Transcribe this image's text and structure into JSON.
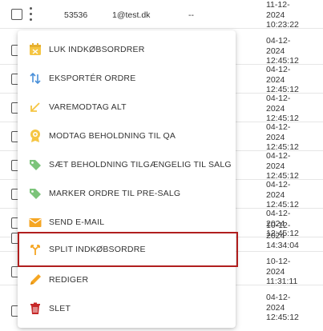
{
  "rows": [
    {
      "id": "53536",
      "email": "1@test.dk",
      "dash": "--",
      "date": [
        "11-12-",
        "2024",
        "10:23:22"
      ]
    },
    {
      "date": [
        "04-12-",
        "2024",
        "12:45:12"
      ]
    },
    {
      "date": [
        "04-12-",
        "2024",
        "12:45:12"
      ]
    },
    {
      "date": [
        "04-12-",
        "2024",
        "12:45:12"
      ]
    },
    {
      "date": [
        "04-12-",
        "2024",
        "12:45:12"
      ]
    },
    {
      "date": [
        "04-12-",
        "2024",
        "12:45:12"
      ]
    },
    {
      "date": [
        "04-12-",
        "2024",
        "12:45:12"
      ]
    },
    {
      "date": [
        "04-12-",
        "2024",
        "12:45:12"
      ]
    },
    {
      "date": [
        "10-12-",
        "2024",
        "14:34:04"
      ]
    },
    {
      "date": [
        "10-12-",
        "2024",
        "11:31:11"
      ]
    },
    {
      "date": [
        "04-12-",
        "2024",
        "12:45:12"
      ]
    }
  ],
  "menu": {
    "items": [
      {
        "label": "LUK INDKØBSORDRER",
        "icon": "calendar-close-icon",
        "color": "#f5c542"
      },
      {
        "label": "EKSPORTÉR ORDRE",
        "icon": "swap-vertical-icon",
        "color": "#4a90d9"
      },
      {
        "label": "VAREMODTAG ALT",
        "icon": "arrow-down-left-icon",
        "color": "#f5c542"
      },
      {
        "label": "MODTAG BEHOLDNING TIL QA",
        "icon": "badge-icon",
        "color": "#f5c542"
      },
      {
        "label": "SÆT BEHOLDNING TILGÆNGELIG TIL SALG",
        "icon": "tag-icon",
        "color": "#7cc47a"
      },
      {
        "label": "MARKER ORDRE TIL PRE-SALG",
        "icon": "tag-icon",
        "color": "#7cc47a"
      },
      {
        "label": "SEND E-MAIL",
        "icon": "envelope-icon",
        "color": "#f5a623"
      },
      {
        "label": "SPLIT INDKØBSORDRE",
        "icon": "split-icon",
        "color": "#f5a623"
      },
      {
        "label": "REDIGER",
        "icon": "pencil-icon",
        "color": "#f5a623"
      },
      {
        "label": "SLET",
        "icon": "trash-icon",
        "color": "#c62828"
      }
    ]
  }
}
